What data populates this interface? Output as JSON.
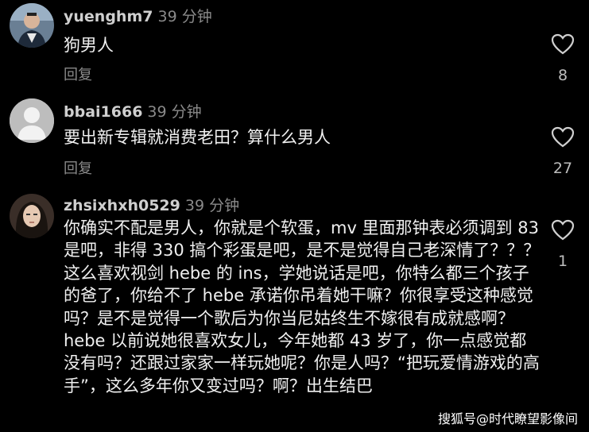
{
  "comments": [
    {
      "username": "yuenghm7",
      "time": "39 分钟",
      "text": "狗男人",
      "reply_label": "回复",
      "likes": "8",
      "avatar_icon": "person-photo-avatar"
    },
    {
      "username": "bbai1666",
      "time": "39 分钟",
      "text": "要出新专辑就消费老田？算什么男人",
      "reply_label": "回复",
      "likes": "27",
      "avatar_icon": "default-person-avatar"
    },
    {
      "username": "zhsixhxh0529",
      "time": "39 分钟",
      "text": "你确实不配是男人，你就是个软蛋，mv 里面那钟表必须调到 83 是吧，非得 330 搞个彩蛋是吧，是不是觉得自己老深情了？？？这么喜欢视剑 hebe 的 ins，学她说话是吧，你特么都三个孩子的爸了，你给不了 hebe 承诺你吊着她干嘛？你很享受这种感觉吗？是不是觉得一个歌后为你当尼姑终生不嫁很有成就感啊？hebe 以前说她很喜欢女儿，今年她都 43 岁了，你一点感觉都没有吗？还跟过家家一样玩她呢？你是人吗？“把玩爱情游戏的高手”，这么多年你又变过吗？啊？出生结巴",
      "likes": "1",
      "avatar_icon": "woman-photo-avatar"
    }
  ],
  "watermark": "搜狐号@时代瞭望影像间",
  "colors": {
    "background": "#000000",
    "text": "#f0f0f0",
    "muted": "#8a8a8a"
  }
}
